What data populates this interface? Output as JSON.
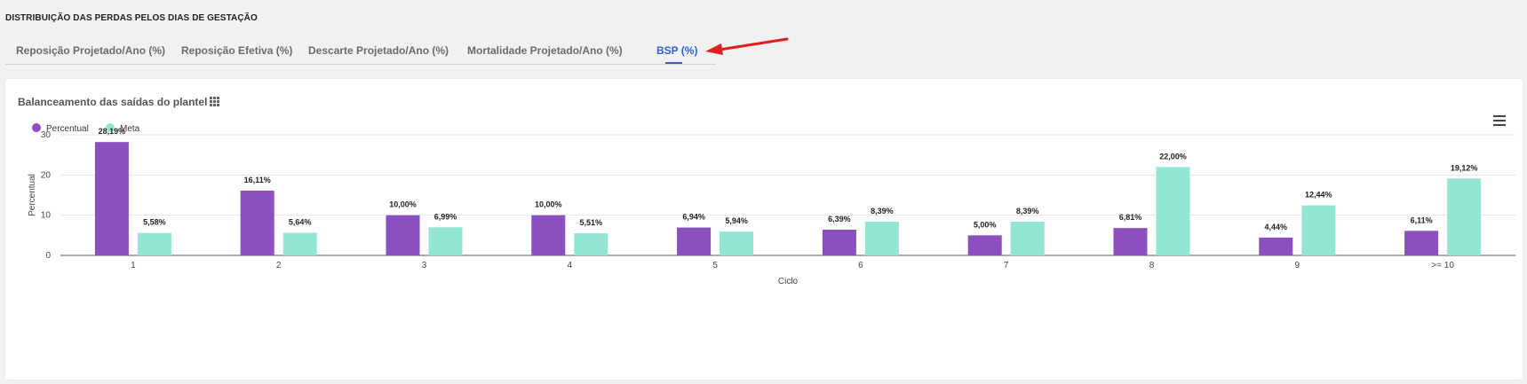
{
  "section_title": "DISTRIBUIÇÃO DAS PERDAS PELOS DIAS DE GESTAÇÃO",
  "tabs": [
    {
      "label": "Reposição Projetado/Ano (%)"
    },
    {
      "label": "Reposição Efetiva (%)"
    },
    {
      "label": "Descarte Projetado/Ano (%)"
    },
    {
      "label": "Mortalidade Projetado/Ano (%)"
    },
    {
      "label": "BSP (%)",
      "active": true
    }
  ],
  "card": {
    "title": "Balanceamento das saídas do plantel",
    "legend": [
      {
        "name": "Percentual",
        "color": "#8b4fbf"
      },
      {
        "name": "Meta",
        "color": "#93e6d4"
      }
    ]
  },
  "colors": {
    "accent": "#2f5fd0",
    "percentual": "#8b4fbf",
    "meta": "#93e6d4",
    "arrow": "#e02020"
  },
  "icons": [
    "grid-icon",
    "menu-icon",
    "arrow-icon"
  ],
  "chart_data": {
    "type": "bar",
    "categories": [
      "1",
      "2",
      "3",
      "4",
      "5",
      "6",
      "7",
      "8",
      "9",
      ">= 10"
    ],
    "series": [
      {
        "name": "Percentual",
        "values": [
          28.19,
          16.11,
          10.0,
          10.0,
          6.94,
          6.39,
          5.0,
          6.81,
          4.44,
          6.11
        ],
        "labels": [
          "28,19%",
          "16,11%",
          "10,00%",
          "10,00%",
          "6,94%",
          "6,39%",
          "5,00%",
          "6,81%",
          "4,44%",
          "6,11%"
        ]
      },
      {
        "name": "Meta",
        "values": [
          5.58,
          5.64,
          6.99,
          5.51,
          5.94,
          8.39,
          8.39,
          22.0,
          12.44,
          19.12
        ],
        "labels": [
          "5,58%",
          "5,64%",
          "6,99%",
          "5,51%",
          "5,94%",
          "8,39%",
          "8,39%",
          "22,00%",
          "12,44%",
          "19,12%"
        ]
      }
    ],
    "xlabel": "Ciclo",
    "ylabel": "Percentual",
    "yticks": [
      0,
      10,
      20,
      30
    ],
    "ylim": [
      0,
      30
    ],
    "grid": true,
    "legend_position": "top-left"
  }
}
